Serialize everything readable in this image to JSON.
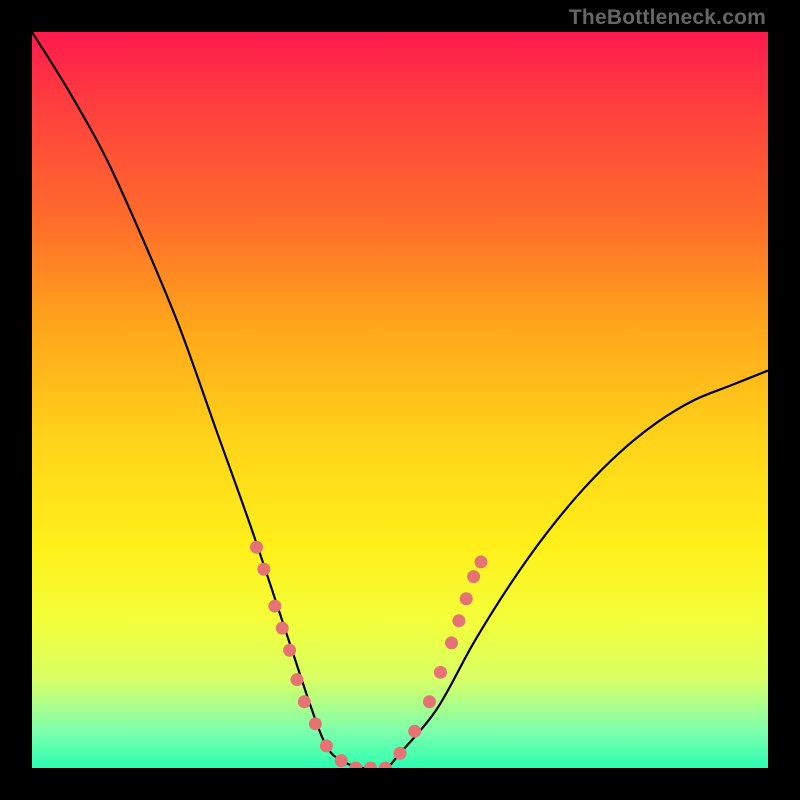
{
  "attribution": "TheBottleneck.com",
  "chart_data": {
    "type": "line",
    "title": "",
    "xlabel": "",
    "ylabel": "",
    "xlim": [
      0,
      100
    ],
    "ylim": [
      0,
      100
    ],
    "background_gradient": {
      "top": "#ff1a4d",
      "mid": "#ffd21a",
      "bottom": "#2bffb0"
    },
    "series": [
      {
        "name": "bottleneck-curve",
        "description": "V-shaped bottleneck curve; y≈100 is max bottleneck (red), y≈0 is minimum (green).",
        "x": [
          0,
          5,
          10,
          15,
          20,
          25,
          30,
          35,
          38,
          40,
          42,
          45,
          48,
          50,
          55,
          60,
          65,
          70,
          75,
          80,
          85,
          90,
          95,
          100
        ],
        "y": [
          100,
          92,
          83,
          72,
          60,
          46,
          32,
          17,
          8,
          3,
          1,
          0,
          0,
          2,
          8,
          17,
          25,
          32,
          38,
          43,
          47,
          50,
          52,
          54
        ]
      }
    ],
    "markers": {
      "name": "highlighted-points",
      "color": "#e57373",
      "points": [
        {
          "x": 30.5,
          "y": 30
        },
        {
          "x": 31.5,
          "y": 27
        },
        {
          "x": 33.0,
          "y": 22
        },
        {
          "x": 34.0,
          "y": 19
        },
        {
          "x": 35.0,
          "y": 16
        },
        {
          "x": 36.0,
          "y": 12
        },
        {
          "x": 37.0,
          "y": 9
        },
        {
          "x": 38.5,
          "y": 6
        },
        {
          "x": 40.0,
          "y": 3
        },
        {
          "x": 42.0,
          "y": 1
        },
        {
          "x": 44.0,
          "y": 0
        },
        {
          "x": 46.0,
          "y": 0
        },
        {
          "x": 48.0,
          "y": 0
        },
        {
          "x": 50.0,
          "y": 2
        },
        {
          "x": 52.0,
          "y": 5
        },
        {
          "x": 54.0,
          "y": 9
        },
        {
          "x": 55.5,
          "y": 13
        },
        {
          "x": 57.0,
          "y": 17
        },
        {
          "x": 58.0,
          "y": 20
        },
        {
          "x": 59.0,
          "y": 23
        },
        {
          "x": 60.0,
          "y": 26
        },
        {
          "x": 61.0,
          "y": 28
        }
      ]
    }
  }
}
